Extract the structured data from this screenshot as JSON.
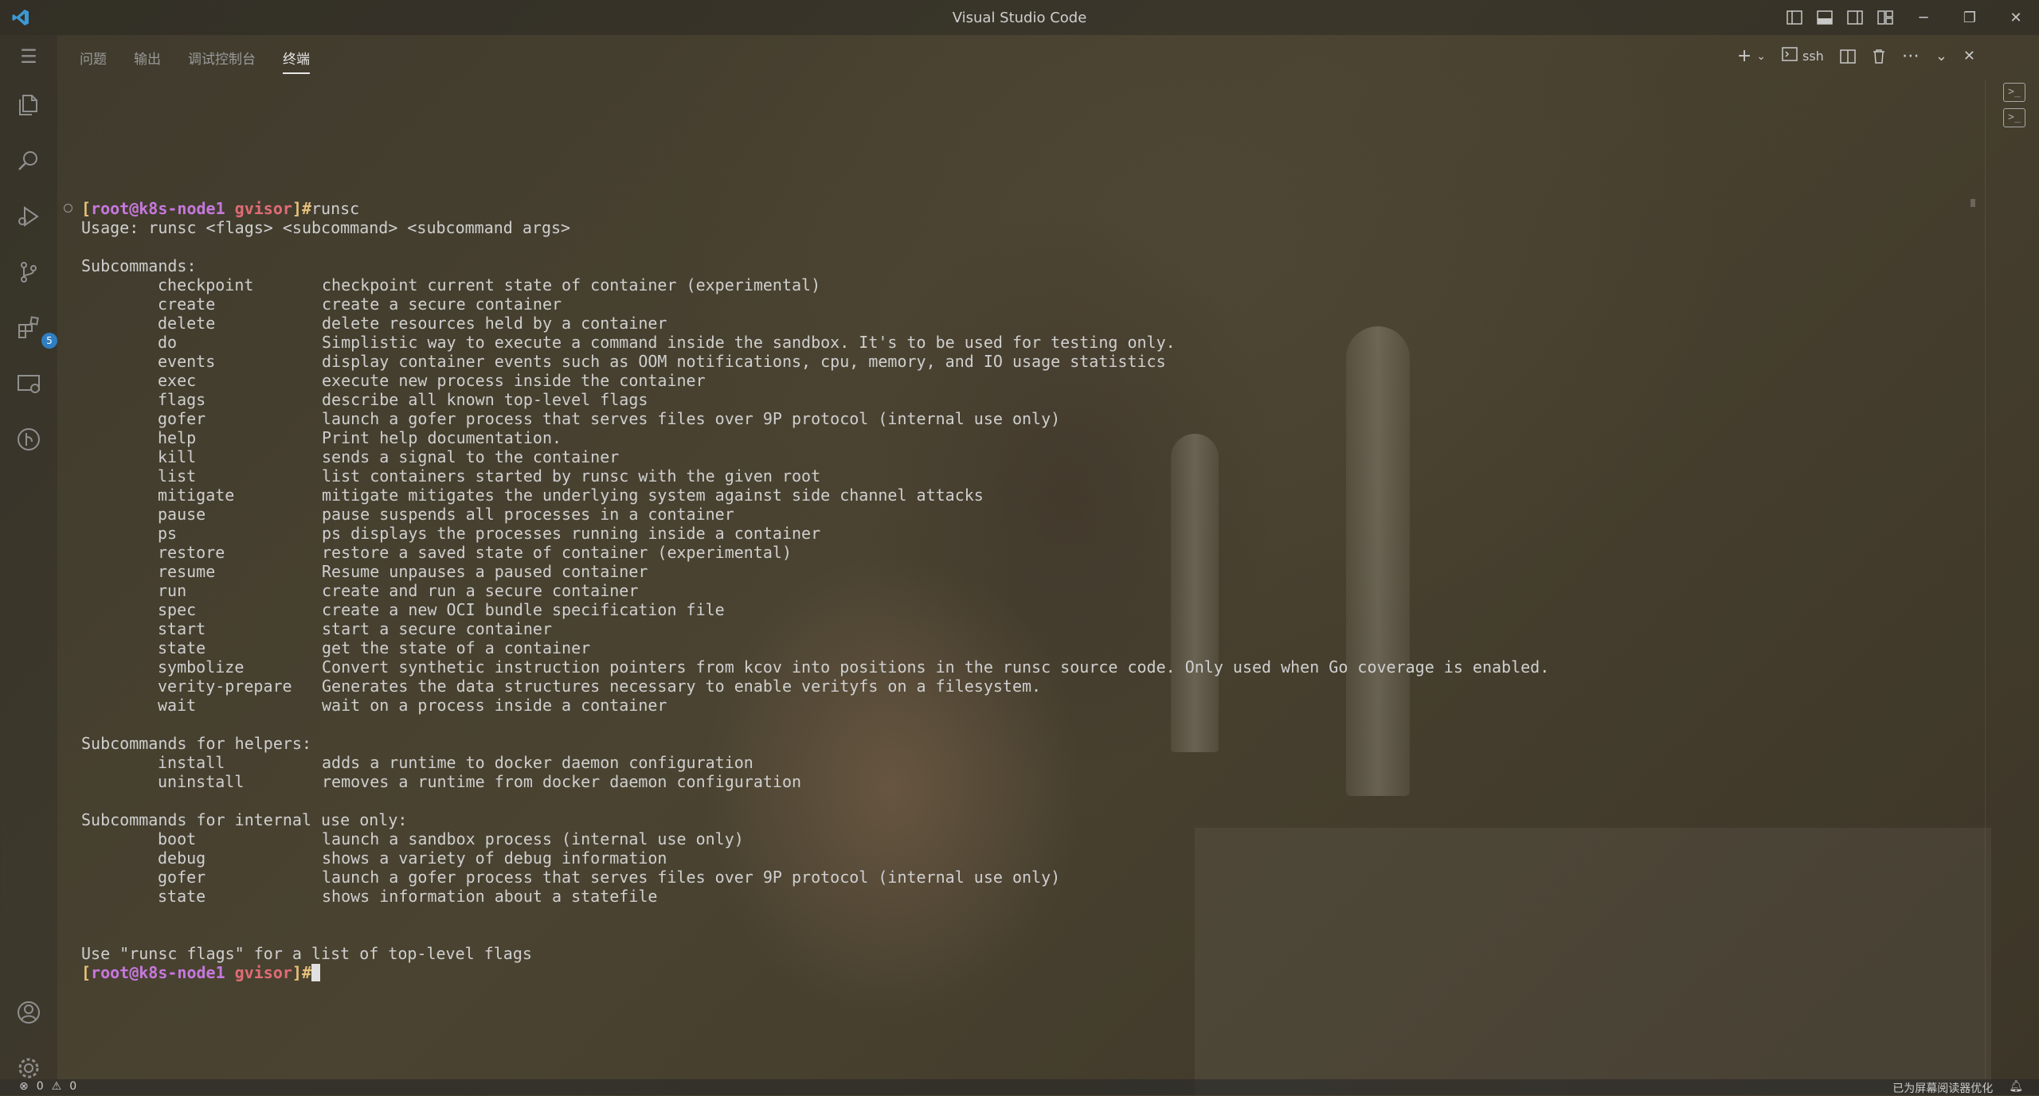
{
  "window": {
    "title": "Visual Studio Code"
  },
  "activity": {
    "extensions_badge": "5"
  },
  "panel": {
    "tabs": [
      "问题",
      "输出",
      "调试控制台",
      "终端"
    ],
    "active_tab": 3,
    "shell_label": "ssh"
  },
  "terminal": {
    "prompt": {
      "open": "[",
      "user_host": "root@k8s-node1",
      "dir": "gvisor",
      "close": "]#"
    },
    "command": "runsc",
    "usage": "Usage: runsc <flags> <subcommand> <subcommand args>",
    "groups": [
      {
        "header": "Subcommands:",
        "items": [
          {
            "name": "checkpoint",
            "desc": "checkpoint current state of container (experimental)"
          },
          {
            "name": "create",
            "desc": "create a secure container"
          },
          {
            "name": "delete",
            "desc": "delete resources held by a container"
          },
          {
            "name": "do",
            "desc": "Simplistic way to execute a command inside the sandbox. It's to be used for testing only."
          },
          {
            "name": "events",
            "desc": "display container events such as OOM notifications, cpu, memory, and IO usage statistics"
          },
          {
            "name": "exec",
            "desc": "execute new process inside the container"
          },
          {
            "name": "flags",
            "desc": "describe all known top-level flags"
          },
          {
            "name": "gofer",
            "desc": "launch a gofer process that serves files over 9P protocol (internal use only)"
          },
          {
            "name": "help",
            "desc": "Print help documentation."
          },
          {
            "name": "kill",
            "desc": "sends a signal to the container"
          },
          {
            "name": "list",
            "desc": "list containers started by runsc with the given root"
          },
          {
            "name": "mitigate",
            "desc": "mitigate mitigates the underlying system against side channel attacks"
          },
          {
            "name": "pause",
            "desc": "pause suspends all processes in a container"
          },
          {
            "name": "ps",
            "desc": "ps displays the processes running inside a container"
          },
          {
            "name": "restore",
            "desc": "restore a saved state of container (experimental)"
          },
          {
            "name": "resume",
            "desc": "Resume unpauses a paused container"
          },
          {
            "name": "run",
            "desc": "create and run a secure container"
          },
          {
            "name": "spec",
            "desc": "create a new OCI bundle specification file"
          },
          {
            "name": "start",
            "desc": "start a secure container"
          },
          {
            "name": "state",
            "desc": "get the state of a container"
          },
          {
            "name": "symbolize",
            "desc": "Convert synthetic instruction pointers from kcov into positions in the runsc source code. Only used when Go coverage is enabled."
          },
          {
            "name": "verity-prepare",
            "desc": "Generates the data structures necessary to enable verityfs on a filesystem."
          },
          {
            "name": "wait",
            "desc": "wait on a process inside a container"
          }
        ]
      },
      {
        "header": "Subcommands for helpers:",
        "items": [
          {
            "name": "install",
            "desc": "adds a runtime to docker daemon configuration"
          },
          {
            "name": "uninstall",
            "desc": "removes a runtime from docker daemon configuration"
          }
        ]
      },
      {
        "header": "Subcommands for internal use only:",
        "items": [
          {
            "name": "boot",
            "desc": "launch a sandbox process (internal use only)"
          },
          {
            "name": "debug",
            "desc": "shows a variety of debug information"
          },
          {
            "name": "gofer",
            "desc": "launch a gofer process that serves files over 9P protocol (internal use only)"
          },
          {
            "name": "state",
            "desc": "shows information about a statefile"
          }
        ]
      }
    ],
    "footer": "Use \"runsc flags\" for a list of top-level flags"
  },
  "status": {
    "errors": "0",
    "warnings": "0",
    "right_text": "已为屏幕阅读器优化"
  }
}
